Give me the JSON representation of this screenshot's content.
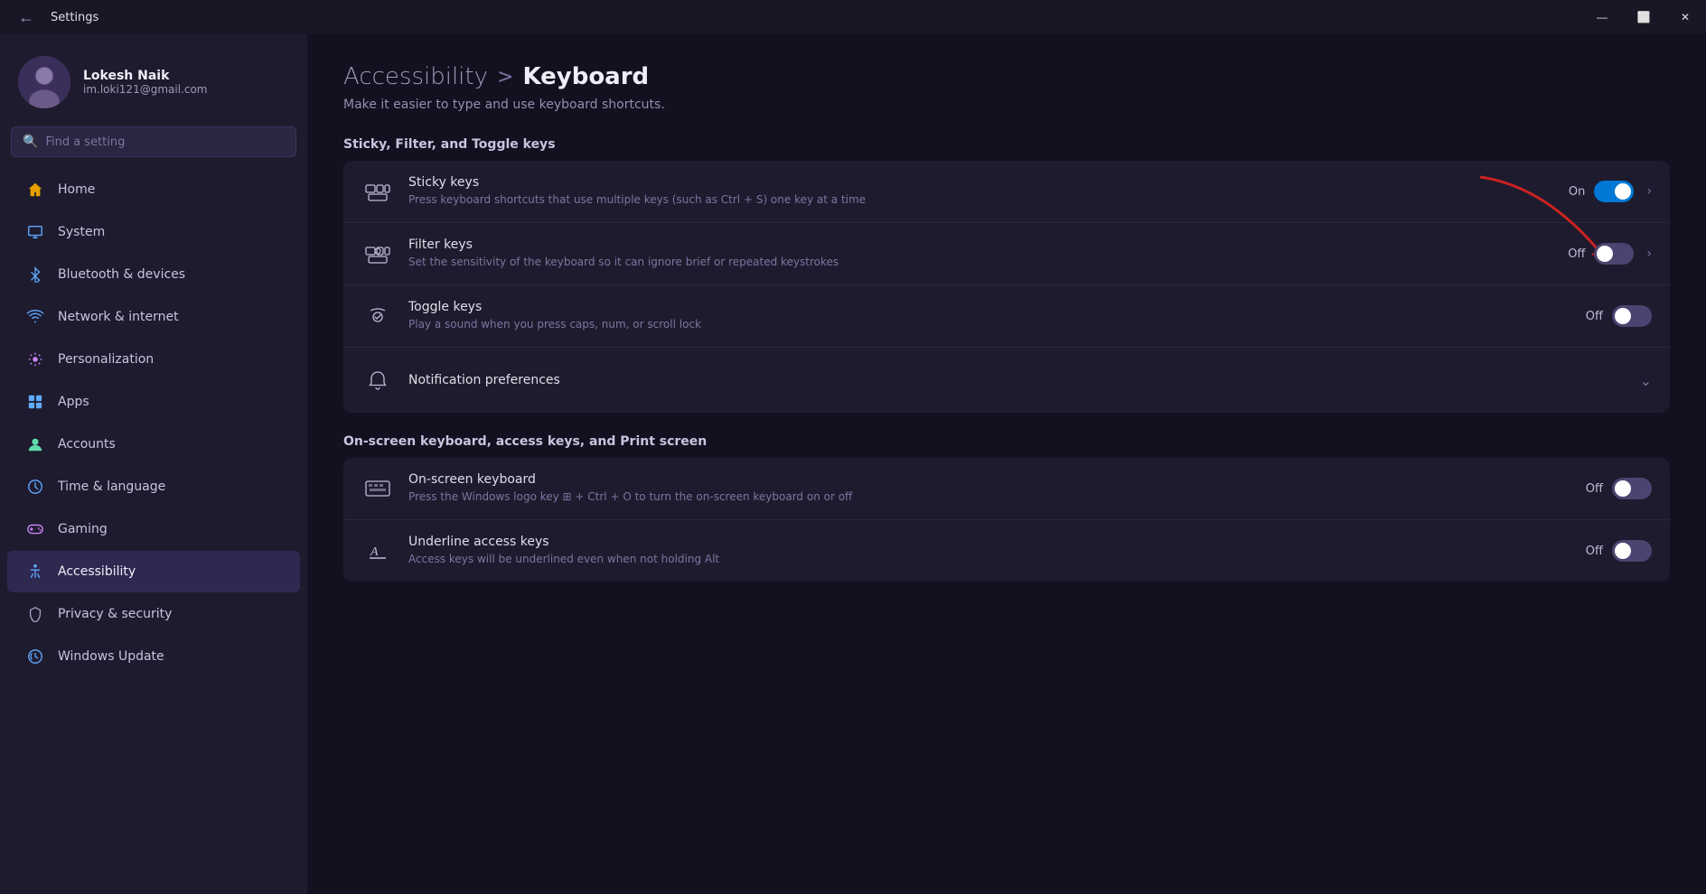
{
  "titlebar": {
    "back_label": "←",
    "title": "Settings",
    "minimize": "—",
    "maximize": "⬜",
    "close": "✕"
  },
  "sidebar": {
    "user": {
      "name": "Lokesh Naik",
      "email": "im.loki121@gmail.com"
    },
    "search_placeholder": "Find a setting",
    "nav": [
      {
        "id": "home",
        "label": "Home",
        "icon": "home"
      },
      {
        "id": "system",
        "label": "System",
        "icon": "system"
      },
      {
        "id": "bluetooth",
        "label": "Bluetooth & devices",
        "icon": "bluetooth"
      },
      {
        "id": "network",
        "label": "Network & internet",
        "icon": "network"
      },
      {
        "id": "personalization",
        "label": "Personalization",
        "icon": "personalization"
      },
      {
        "id": "apps",
        "label": "Apps",
        "icon": "apps"
      },
      {
        "id": "accounts",
        "label": "Accounts",
        "icon": "accounts"
      },
      {
        "id": "time",
        "label": "Time & language",
        "icon": "time"
      },
      {
        "id": "gaming",
        "label": "Gaming",
        "icon": "gaming"
      },
      {
        "id": "accessibility",
        "label": "Accessibility",
        "icon": "accessibility",
        "active": true
      },
      {
        "id": "privacy",
        "label": "Privacy & security",
        "icon": "privacy"
      },
      {
        "id": "windows-update",
        "label": "Windows Update",
        "icon": "update"
      }
    ]
  },
  "content": {
    "breadcrumb_parent": "Accessibility",
    "breadcrumb_sep": ">",
    "breadcrumb_current": "Keyboard",
    "subtitle": "Make it easier to type and use keyboard shortcuts.",
    "section1_title": "Sticky, Filter, and Toggle keys",
    "settings": [
      {
        "id": "sticky-keys",
        "name": "Sticky keys",
        "desc": "Press keyboard shortcuts that use multiple keys (such as Ctrl + S) one key at a time",
        "status": "On",
        "toggle": "on",
        "has_chevron": true
      },
      {
        "id": "filter-keys",
        "name": "Filter keys",
        "desc": "Set the sensitivity of the keyboard so it can ignore brief or repeated keystrokes",
        "status": "Off",
        "toggle": "off",
        "has_chevron": true
      },
      {
        "id": "toggle-keys",
        "name": "Toggle keys",
        "desc": "Play a sound when you press caps, num, or scroll lock",
        "status": "Off",
        "toggle": "off",
        "has_chevron": false
      },
      {
        "id": "notification-prefs",
        "name": "Notification preferences",
        "is_expandable": true
      }
    ],
    "section2_title": "On-screen keyboard, access keys, and Print screen",
    "settings2": [
      {
        "id": "on-screen-keyboard",
        "name": "On-screen keyboard",
        "desc": "Press the Windows logo key ⊞ + Ctrl + O to turn the on-screen keyboard on or off",
        "status": "Off",
        "toggle": "off"
      },
      {
        "id": "underline-access-keys",
        "name": "Underline access keys",
        "desc": "Access keys will be underlined even when not holding Alt",
        "status": "Off",
        "toggle": "off"
      }
    ]
  }
}
